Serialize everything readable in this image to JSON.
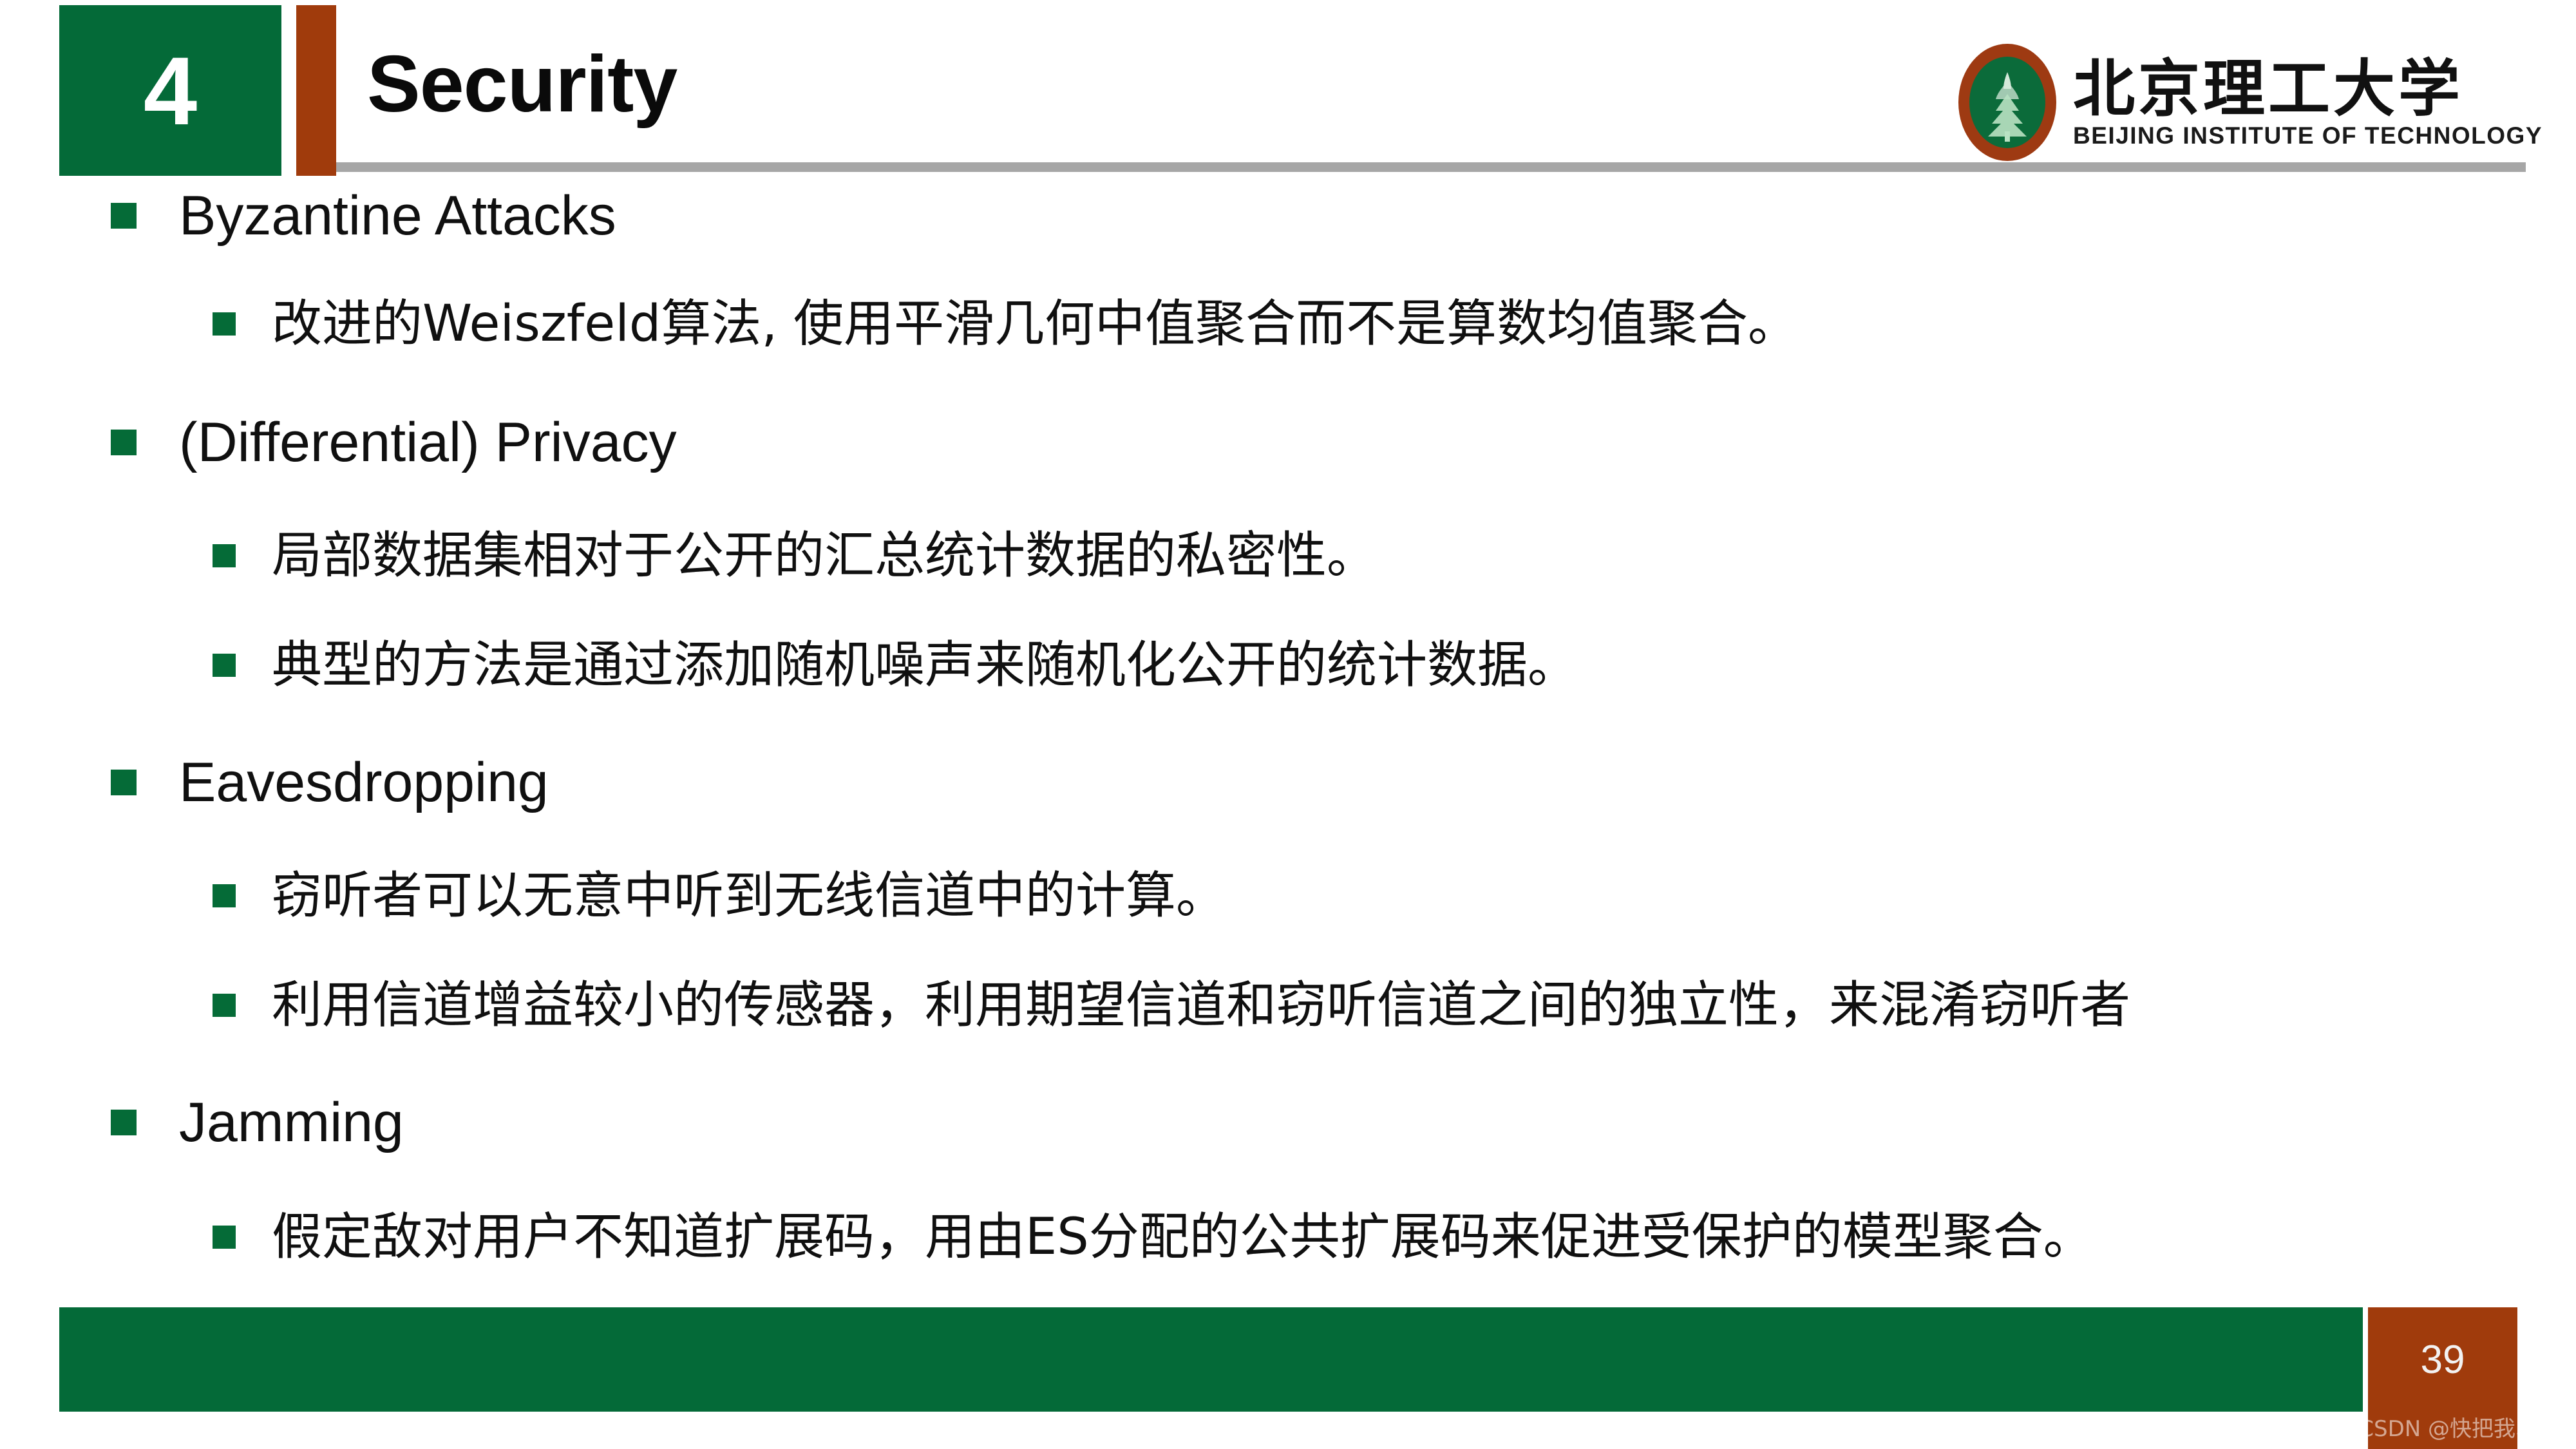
{
  "slide": {
    "section_number": "4",
    "title": "Security",
    "page_number": "39",
    "watermark": "CSDN @快把我骂醒"
  },
  "logo": {
    "name_cn": "北京理工大学",
    "name_en": "BEIJING INSTITUTE OF TECHNOLOGY",
    "seal_icon": "university-seal-icon"
  },
  "colors": {
    "green": "#046A38",
    "orange": "#A03B0C",
    "rule_grey": "#A6A6A6",
    "bullet_green": "#056B37",
    "text": "#101010"
  },
  "content": {
    "bullets": [
      {
        "level": 1,
        "text": "Byzantine Attacks"
      },
      {
        "level": 2,
        "text": "改进的Weiszfeld算法, 使用平滑几何中值聚合而不是算数均值聚合。"
      },
      {
        "level": 1,
        "text": "(Differential) Privacy"
      },
      {
        "level": 2,
        "text": "局部数据集相对于公开的汇总统计数据的私密性。"
      },
      {
        "level": 2,
        "text": "典型的方法是通过添加随机噪声来随机化公开的统计数据。"
      },
      {
        "level": 1,
        "text": "Eavesdropping"
      },
      {
        "level": 2,
        "text": "窃听者可以无意中听到无线信道中的计算。"
      },
      {
        "level": 2,
        "text": "利用信道增益较小的传感器，利用期望信道和窃听信道之间的独立性，来混淆窃听者"
      },
      {
        "level": 1,
        "text": "Jamming"
      },
      {
        "level": 2,
        "text": "假定敌对用户不知道扩展码，用由ES分配的公共扩展码来促进受保护的模型聚合。"
      }
    ]
  }
}
